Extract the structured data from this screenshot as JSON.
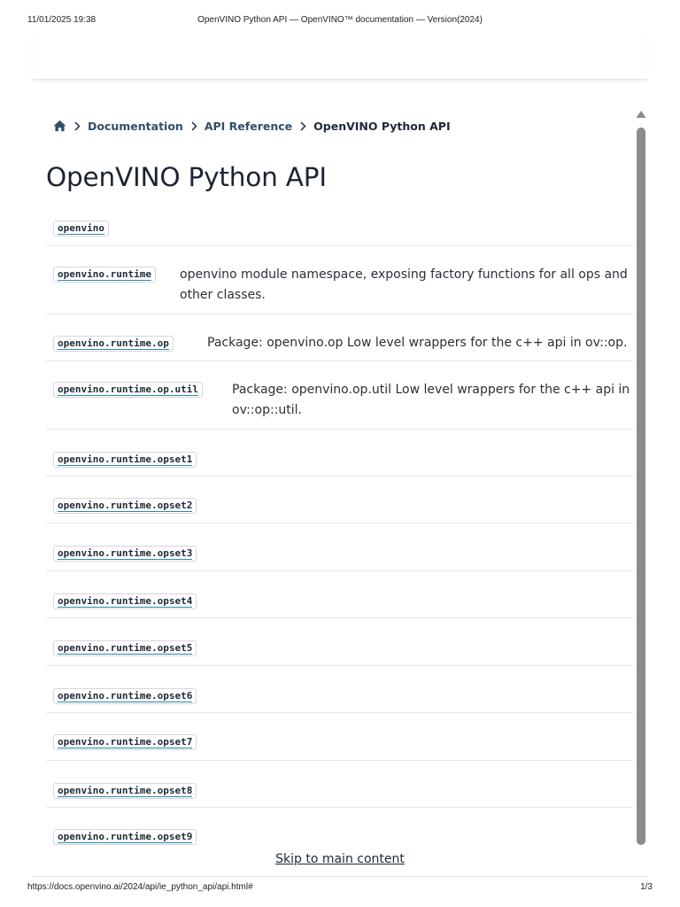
{
  "print_header": {
    "datetime": "11/01/2025 19:38",
    "title": "OpenVINO Python API — OpenVINO™ documentation — Version(2024)"
  },
  "breadcrumb": {
    "home_icon": "home-icon",
    "items": [
      "Documentation",
      "API Reference"
    ],
    "current": "OpenVINO Python API"
  },
  "page_title": "OpenVINO Python API",
  "api_modules": [
    {
      "name": "openvino",
      "description": ""
    },
    {
      "name": "openvino.runtime",
      "description_lines": [
        "openvino module namespace, exposing factory functions for all ops and",
        "other classes."
      ]
    },
    {
      "name": "openvino.runtime.op",
      "description_lines": [
        "Package: openvino.op Low level wrappers for the c++ api in ov::op."
      ]
    },
    {
      "name": "openvino.runtime.op.util",
      "description_lines": [
        "Package: openvino.op.util Low level wrappers for the c++ api in",
        "ov::op::util."
      ]
    },
    {
      "name": "openvino.runtime.opset1",
      "description": ""
    },
    {
      "name": "openvino.runtime.opset2",
      "description": ""
    },
    {
      "name": "openvino.runtime.opset3",
      "description": ""
    },
    {
      "name": "openvino.runtime.opset4",
      "description": ""
    },
    {
      "name": "openvino.runtime.opset5",
      "description": ""
    },
    {
      "name": "openvino.runtime.opset6",
      "description": ""
    },
    {
      "name": "openvino.runtime.opset7",
      "description": ""
    },
    {
      "name": "openvino.runtime.opset8",
      "description": ""
    },
    {
      "name": "openvino.runtime.opset9",
      "description": ""
    }
  ],
  "skip_link": "Skip to main content",
  "print_footer": {
    "url": "https://docs.openvino.ai/2024/api/ie_python_api/api.html#",
    "page": "1/3"
  },
  "colors": {
    "link_underline": "#2a8ab0",
    "breadcrumb_link": "#334e68",
    "scrollbar_thumb": "#8c8c8c"
  }
}
